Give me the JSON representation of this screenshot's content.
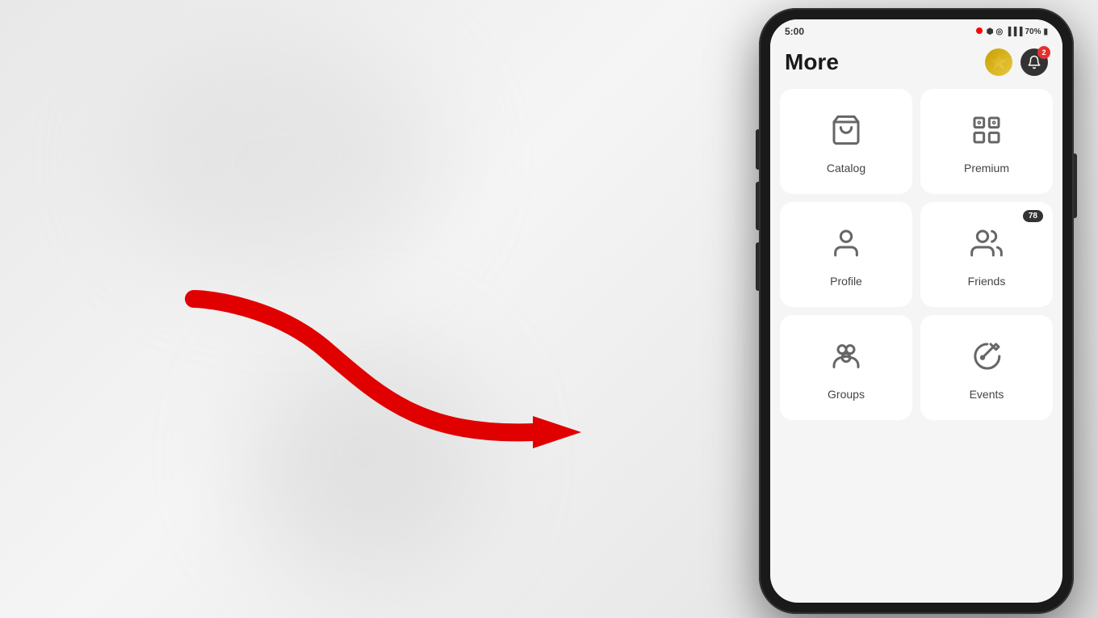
{
  "background": {
    "color": "#e8e8e8"
  },
  "phone": {
    "status_bar": {
      "time": "5:00",
      "battery": "70%",
      "signal_icons": "🔵 ⬡ 📶 🔋"
    },
    "header": {
      "title": "More",
      "coin_icon": "coin-icon",
      "bell_badge": "2"
    },
    "grid_items": [
      {
        "id": "catalog",
        "label": "Catalog",
        "icon": "bag",
        "badge": null
      },
      {
        "id": "premium",
        "label": "Premium",
        "icon": "premium",
        "badge": null
      },
      {
        "id": "profile",
        "label": "Profile",
        "icon": "person",
        "badge": null
      },
      {
        "id": "friends",
        "label": "Friends",
        "icon": "friends",
        "badge": "78"
      },
      {
        "id": "groups",
        "label": "Groups",
        "icon": "groups",
        "badge": null
      },
      {
        "id": "events",
        "label": "Events",
        "icon": "events",
        "badge": null
      }
    ]
  },
  "arrow": {
    "color": "#e00000"
  }
}
